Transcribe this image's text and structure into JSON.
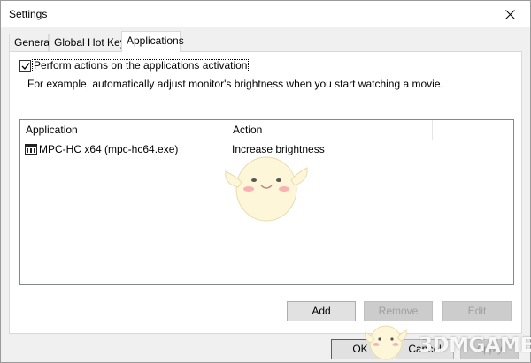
{
  "window": {
    "title": "Settings",
    "close_icon": "close-icon"
  },
  "tabs": [
    {
      "label": "General",
      "active": false
    },
    {
      "label": "Global Hot Keys",
      "active": false
    },
    {
      "label": "Applications",
      "active": true
    }
  ],
  "applications": {
    "checkbox_label": "Perform actions on the applications activation",
    "checkbox_checked": true,
    "hint": "For example, automatically adjust monitor's brightness when you start watching a movie.",
    "columns": [
      "Application",
      "Action"
    ],
    "rows": [
      {
        "application": "MPC-HC x64 (mpc-hc64.exe)",
        "action": "Increase brightness",
        "icon": "mpc-hc-app-icon"
      }
    ],
    "buttons": {
      "add": "Add",
      "remove": "Remove",
      "edit": "Edit"
    }
  },
  "dialog_buttons": {
    "ok": "OK",
    "cancel": "Cancel",
    "apply": "Apply"
  },
  "watermark": "3DMGAME"
}
